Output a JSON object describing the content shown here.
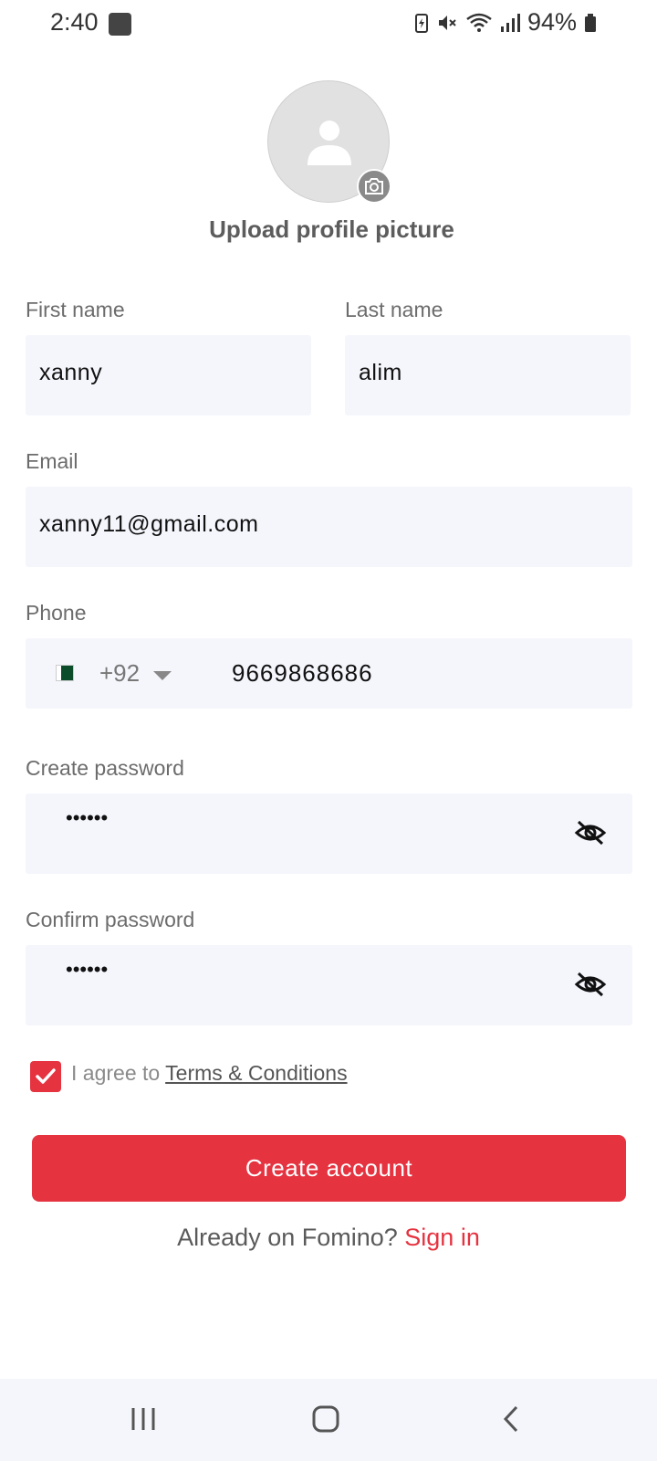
{
  "status_bar": {
    "time": "2:40",
    "battery": "94%"
  },
  "profile": {
    "upload_label": "Upload profile picture"
  },
  "form": {
    "first_name": {
      "label": "First name",
      "value": "xanny"
    },
    "last_name": {
      "label": "Last name",
      "value": "alim"
    },
    "email": {
      "label": "Email",
      "value": "xanny11@gmail.com"
    },
    "phone": {
      "label": "Phone",
      "country_code": "+92",
      "number": "9669868686"
    },
    "create_password": {
      "label": "Create password",
      "masked_value": "••••••"
    },
    "confirm_password": {
      "label": "Confirm password",
      "masked_value": "••••••"
    }
  },
  "terms": {
    "prefix": "I agree to ",
    "link": "Terms & Conditions",
    "checked": true
  },
  "actions": {
    "create_account": "Create account",
    "signin_prompt": "Already on Fomino? ",
    "signin_link": "Sign in"
  },
  "colors": {
    "accent": "#e53340",
    "field_bg": "#f5f6fc"
  }
}
